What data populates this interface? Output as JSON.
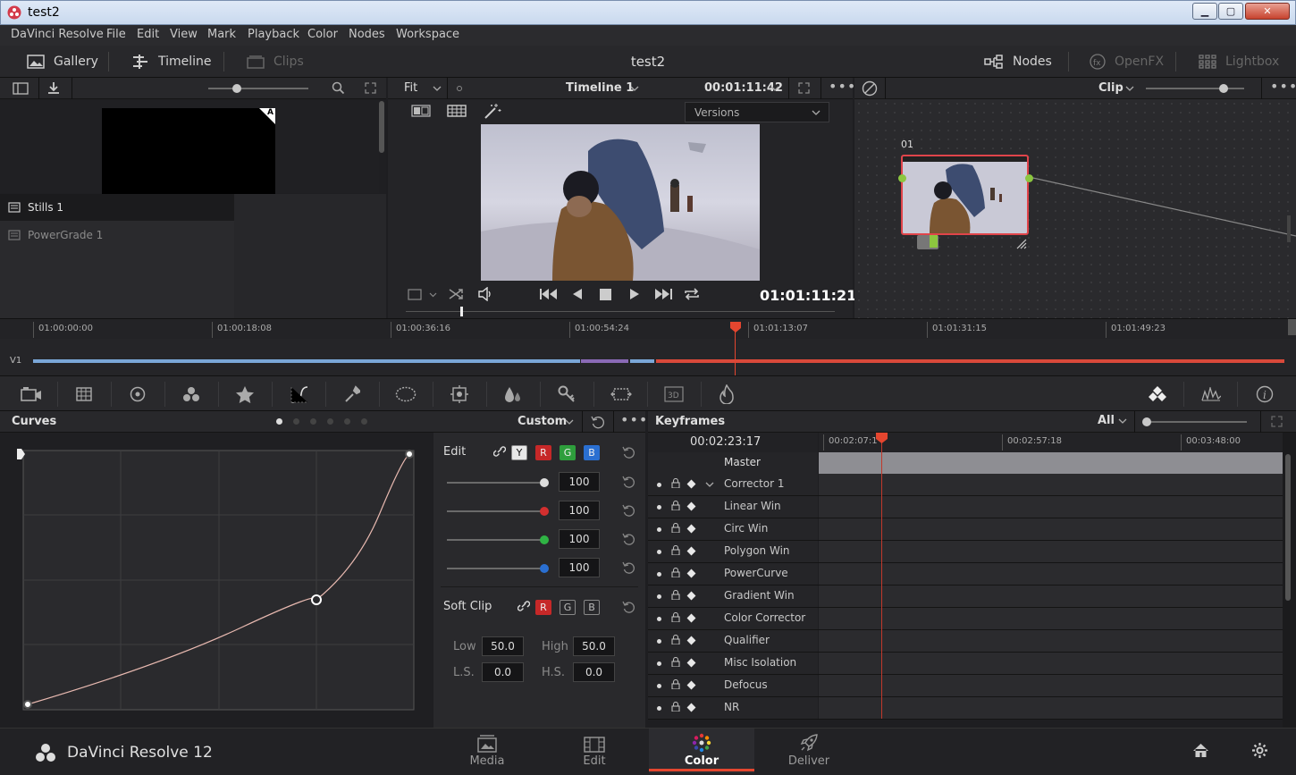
{
  "window": {
    "title": "test2",
    "min_label": "▁",
    "max_label": "▢",
    "close_label": "✕"
  },
  "menu": [
    "DaVinci Resolve",
    "File",
    "Edit",
    "View",
    "Mark",
    "Playback",
    "Color",
    "Nodes",
    "Workspace"
  ],
  "toolbar": {
    "gallery": "Gallery",
    "timeline": "Timeline",
    "clips": "Clips",
    "project": "test2",
    "nodes": "Nodes",
    "openfx": "OpenFX",
    "lightbox": "Lightbox"
  },
  "gallery": {
    "still_badge": "A",
    "albums": [
      "Stills 1",
      "PowerGrade 1"
    ]
  },
  "viewer": {
    "fit": "Fit",
    "timeline_name": "Timeline 1",
    "header_tc": "00:01:11:42",
    "versions": "Versions",
    "playhead_tc": "01:01:11:21"
  },
  "nodes": {
    "mode": "Clip",
    "node_label": "01"
  },
  "timeline": {
    "ticks": [
      "01:00:00:00",
      "01:00:18:08",
      "01:00:36:16",
      "01:00:54:24",
      "01:01:13:07",
      "01:01:31:15",
      "01:01:49:23"
    ],
    "track": "V1"
  },
  "curves": {
    "title": "Curves",
    "mode": "Custom",
    "edit_label": "Edit",
    "channels": [
      "Y",
      "R",
      "G",
      "B"
    ],
    "intensity": [
      "100",
      "100",
      "100",
      "100"
    ],
    "soft_clip": "Soft Clip",
    "low_label": "Low",
    "low": "50.0",
    "high_label": "High",
    "high": "50.0",
    "ls_label": "L.S.",
    "ls": "0.0",
    "hs_label": "H.S.",
    "hs": "0.0"
  },
  "keyframes": {
    "title": "Keyframes",
    "filter": "All",
    "current_tc": "00:02:23:17",
    "ruler": [
      "00:02:07:1",
      "00:02:57:18",
      "00:03:48:00"
    ],
    "master": "Master",
    "tracks": [
      "Corrector 1",
      "Linear Win",
      "Circ Win",
      "Polygon Win",
      "PowerCurve",
      "Gradient Win",
      "Color Corrector",
      "Qualifier",
      "Misc Isolation",
      "Defocus",
      "NR"
    ]
  },
  "footer": {
    "app_name": "DaVinci Resolve 12",
    "pages": [
      "Media",
      "Edit",
      "Color",
      "Deliver"
    ],
    "active_page": "Color"
  },
  "colors": {
    "accent": "#e5462f",
    "bg": "#1e1e21",
    "panel": "#28282b",
    "node_border": "#e0444a",
    "clip_blue": "#7aa7d8",
    "clip_purple": "#8a6ab6",
    "clip_red": "#d9493a"
  }
}
